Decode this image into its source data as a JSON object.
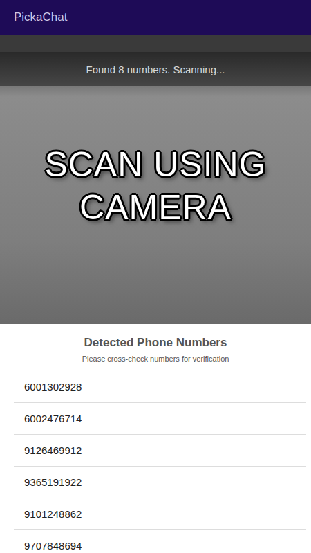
{
  "app_bar": {
    "title": "PickaChat"
  },
  "scanner": {
    "status": "Found 8 numbers. Scanning..."
  },
  "caption": {
    "lines": [
      "SCAN USING",
      "CAMERA"
    ]
  },
  "sheet": {
    "title": "Detected Phone Numbers",
    "subtitle": "Please cross-check numbers for verification",
    "numbers": [
      "6001302928",
      "6002476714",
      "9126469912",
      "9365191922",
      "9101248862",
      "9707848694"
    ]
  }
}
